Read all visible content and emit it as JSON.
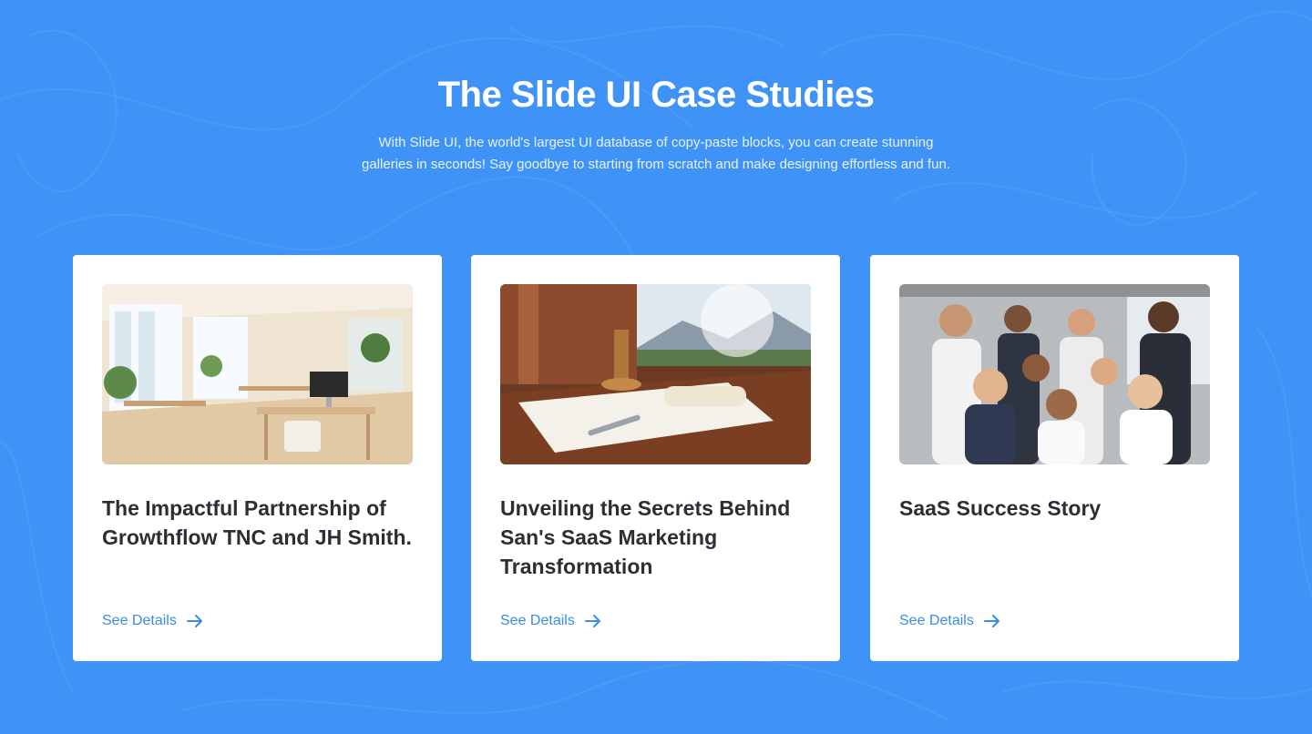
{
  "header": {
    "title": "The Slide UI Case Studies",
    "subtitle": "With Slide UI, the world's largest UI database of copy-paste blocks, you can create stunning galleries in seconds! Say goodbye to starting from scratch and make designing effortless and fun."
  },
  "cards": [
    {
      "image_icon": "office-interior-photo",
      "title": "The Impactful Partnership of Growthflow TNC and JH Smith.",
      "link_label": "See Details",
      "link_icon": "arrow-right-icon"
    },
    {
      "image_icon": "desk-documents-photo",
      "title": "Unveiling the Secrets Behind San's SaaS Marketing Transformation",
      "link_label": "See Details",
      "link_icon": "arrow-right-icon"
    },
    {
      "image_icon": "team-group-photo",
      "title": "SaaS Success Story",
      "link_label": "See Details",
      "link_icon": "arrow-right-icon"
    }
  ],
  "colors": {
    "background": "#3f93f6",
    "card": "#ffffff",
    "title_text": "#2a2f36",
    "link": "#3a8de0"
  }
}
